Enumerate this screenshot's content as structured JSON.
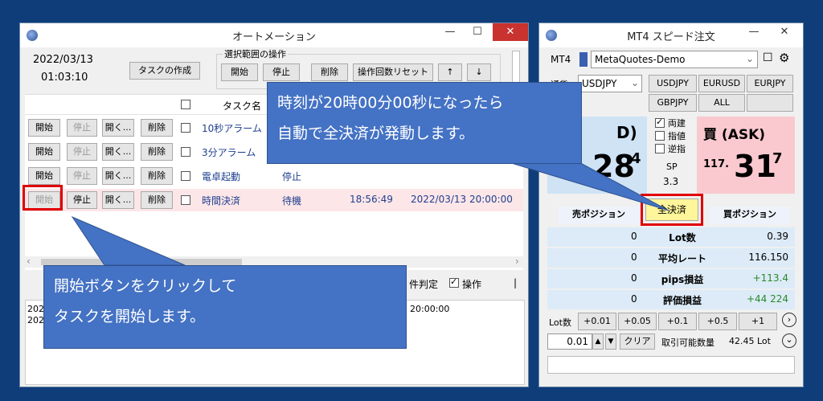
{
  "automation": {
    "title": "オートメーション",
    "date": "2022/03/13",
    "time": "01:03:10",
    "create_task_label": "タスクの作成",
    "range_group_label": "選択範囲の操作",
    "range_buttons": [
      "開始",
      "停止",
      "削除",
      "操作回数リセット",
      "↑",
      "↓"
    ],
    "column_task_name": "タスク名",
    "rows": [
      {
        "start": "開始",
        "stop": "停止",
        "open": "開く...",
        "delete": "削除",
        "name": "10秒アラーム",
        "status": "",
        "time": "",
        "datetime": "",
        "start_enabled": true,
        "stop_enabled": false
      },
      {
        "start": "開始",
        "stop": "停止",
        "open": "開く...",
        "delete": "削除",
        "name": "3分アラーム",
        "status": "",
        "time": "",
        "datetime": "",
        "start_enabled": true,
        "stop_enabled": false
      },
      {
        "start": "開始",
        "stop": "停止",
        "open": "開く...",
        "delete": "削除",
        "name": "電卓起動",
        "status": "停止",
        "time": "",
        "datetime": "",
        "start_enabled": true,
        "stop_enabled": false
      },
      {
        "start": "開始",
        "stop": "停止",
        "open": "開く...",
        "delete": "削除",
        "name": "時間決済",
        "status": "待機",
        "time": "18:56:49",
        "datetime": "2022/03/13 20:00:00",
        "start_enabled": false,
        "stop_enabled": true
      }
    ],
    "bottom_condition_label": "件判定",
    "bottom_operation_label": "操作",
    "log_lines": [
      "202",
      "202"
    ],
    "log_time": "20:00:00"
  },
  "callouts": {
    "top": [
      "時刻が20時00分00秒になったら",
      "自動で全決済が発動します。"
    ],
    "bottom": [
      "開始ボタンをクリックして",
      "タスクを開始します。"
    ]
  },
  "mt4": {
    "title": "MT4 スピード注文",
    "label_mt4": "MT4",
    "account": "MetaQuotes-Demo",
    "currency_label": "通貨",
    "currency": "USDJPY",
    "pairs": [
      "USDJPY",
      "EURUSD",
      "EURJPY",
      "GBPJPY",
      "ALL",
      ""
    ],
    "bid_big": "28",
    "bid_sup": "4",
    "bid_head": "D)",
    "ask_title": "買 (ASK)",
    "ask_prefix": "117.",
    "ask_big": "31",
    "ask_sup": "7",
    "check_both": "両建",
    "check_limit": "指値",
    "check_stop": "逆指",
    "sp_label": "SP",
    "sp_value": "3.3",
    "close_all": "全決済",
    "sell_position": "売ポジション",
    "buy_position": "買ポジション",
    "stats": [
      {
        "left": "0",
        "label": "Lot数",
        "right": "0.39",
        "green": false
      },
      {
        "left": "0",
        "label": "平均レート",
        "right": "116.150",
        "green": false
      },
      {
        "left": "0",
        "label": "pips損益",
        "right": "+113.4",
        "green": true
      },
      {
        "left": "0",
        "label": "評価損益",
        "right": "+44 224",
        "green": true
      }
    ],
    "lot_label": "Lot数",
    "lot_steps": [
      "+0.01",
      "+0.05",
      "+0.1",
      "+0.5",
      "+1"
    ],
    "lot_value": "0.01",
    "clear_label": "クリア",
    "tradable_label": "取引可能数量",
    "tradable_value": "42.45 Lot"
  },
  "colors": {
    "close_highlight": "#e00000",
    "ask_bg": "#f9c9cf",
    "callout": "#4472c4",
    "green": "#2a8a2a"
  }
}
